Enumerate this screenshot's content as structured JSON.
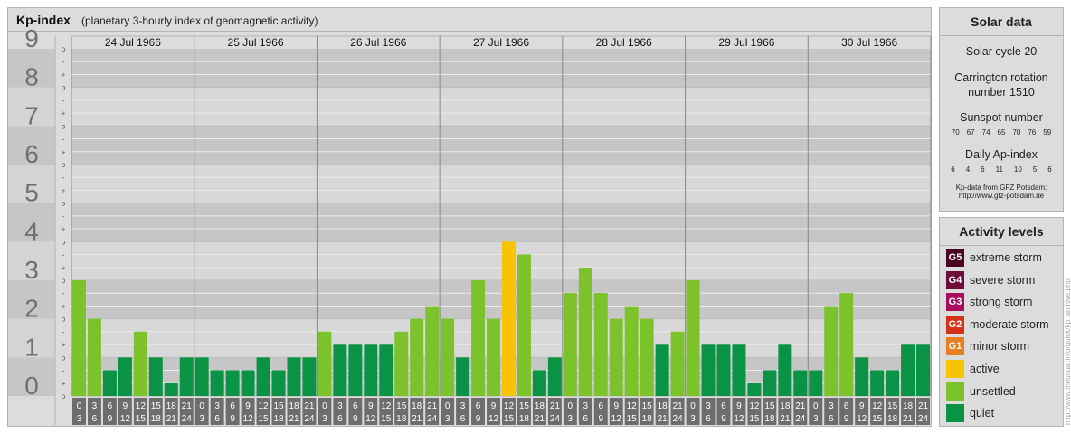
{
  "header": {
    "title": "Kp-index",
    "subtitle": "(planetary 3-hourly index of geomagnetic activity)"
  },
  "chart_data": {
    "type": "bar",
    "title": "Kp-index",
    "subtitle": "(planetary 3-hourly index of geomagnetic activity)",
    "ylim": [
      0,
      9
    ],
    "y_major_ticks": [
      "0",
      "1",
      "2",
      "3",
      "4",
      "5",
      "6",
      "7",
      "8",
      "9"
    ],
    "y_minor_marks": [
      "o",
      "+",
      "-"
    ],
    "days": [
      "24 Jul 1966",
      "25 Jul 1966",
      "26 Jul 1966",
      "27 Jul 1966",
      "28 Jul 1966",
      "29 Jul 1966",
      "30 Jul 1966"
    ],
    "interval_top": [
      "0",
      "3",
      "6",
      "9",
      "12",
      "15",
      "18",
      "21"
    ],
    "interval_bottom": [
      "3",
      "6",
      "9",
      "12",
      "15",
      "18",
      "21",
      "24"
    ],
    "values": [
      [
        3.0,
        2.0,
        0.67,
        1.0,
        1.67,
        1.0,
        0.33,
        1.0
      ],
      [
        1.0,
        0.67,
        0.67,
        0.67,
        1.0,
        0.67,
        1.0,
        1.0
      ],
      [
        1.67,
        1.33,
        1.33,
        1.33,
        1.33,
        1.67,
        2.0,
        2.33
      ],
      [
        2.0,
        1.0,
        3.0,
        2.0,
        4.0,
        3.67,
        0.67,
        1.0
      ],
      [
        2.67,
        3.33,
        2.67,
        2.0,
        2.33,
        2.0,
        1.33,
        1.67
      ],
      [
        3.0,
        1.33,
        1.33,
        1.33,
        0.33,
        0.67,
        1.33,
        0.67
      ],
      [
        0.67,
        2.33,
        2.67,
        1.0,
        0.67,
        0.67,
        1.33,
        1.33
      ]
    ],
    "grid": true,
    "colors": {
      "quiet": "#0a9245",
      "unsettled": "#7cc22b",
      "active": "#f8c400",
      "minor_storm": "#e67e22",
      "moderate_storm": "#d4311b",
      "strong_storm": "#a80d5e",
      "severe_storm": "#6e0b3a",
      "extreme_storm": "#4a0620"
    }
  },
  "solar": {
    "heading": "Solar data",
    "cycle": "Solar cycle 20",
    "carrington_1": "Carrington rotation",
    "carrington_2": "number 1510",
    "sunspot_label": "Sunspot number",
    "sunspot_values": [
      "70",
      "67",
      "74",
      "65",
      "70",
      "76",
      "59"
    ],
    "ap_label": "Daily Ap-index",
    "ap_values": [
      "6",
      "4",
      "6",
      "11",
      "10",
      "5",
      "6"
    ],
    "source_1": "Kp-data from GFZ Potsdam:",
    "source_2": "http://www.gfz-potsdam.de"
  },
  "activity": {
    "heading": "Activity levels",
    "levels": [
      {
        "badge": "G5",
        "label": "extreme storm",
        "color": "#4a0620"
      },
      {
        "badge": "G4",
        "label": "severe storm",
        "color": "#6e0b3a"
      },
      {
        "badge": "G3",
        "label": "strong storm",
        "color": "#a80d5e"
      },
      {
        "badge": "G2",
        "label": "moderate storm",
        "color": "#d4311b"
      },
      {
        "badge": "G1",
        "label": "minor storm",
        "color": "#e67e22"
      },
      {
        "badge": "",
        "label": "active",
        "color": "#f8c400"
      },
      {
        "badge": "",
        "label": "unsettled",
        "color": "#7cc22b"
      },
      {
        "badge": "",
        "label": "quiet",
        "color": "#0a9245"
      }
    ]
  },
  "watermark": "http://www.theusual.info/quick/kp_archive.php"
}
